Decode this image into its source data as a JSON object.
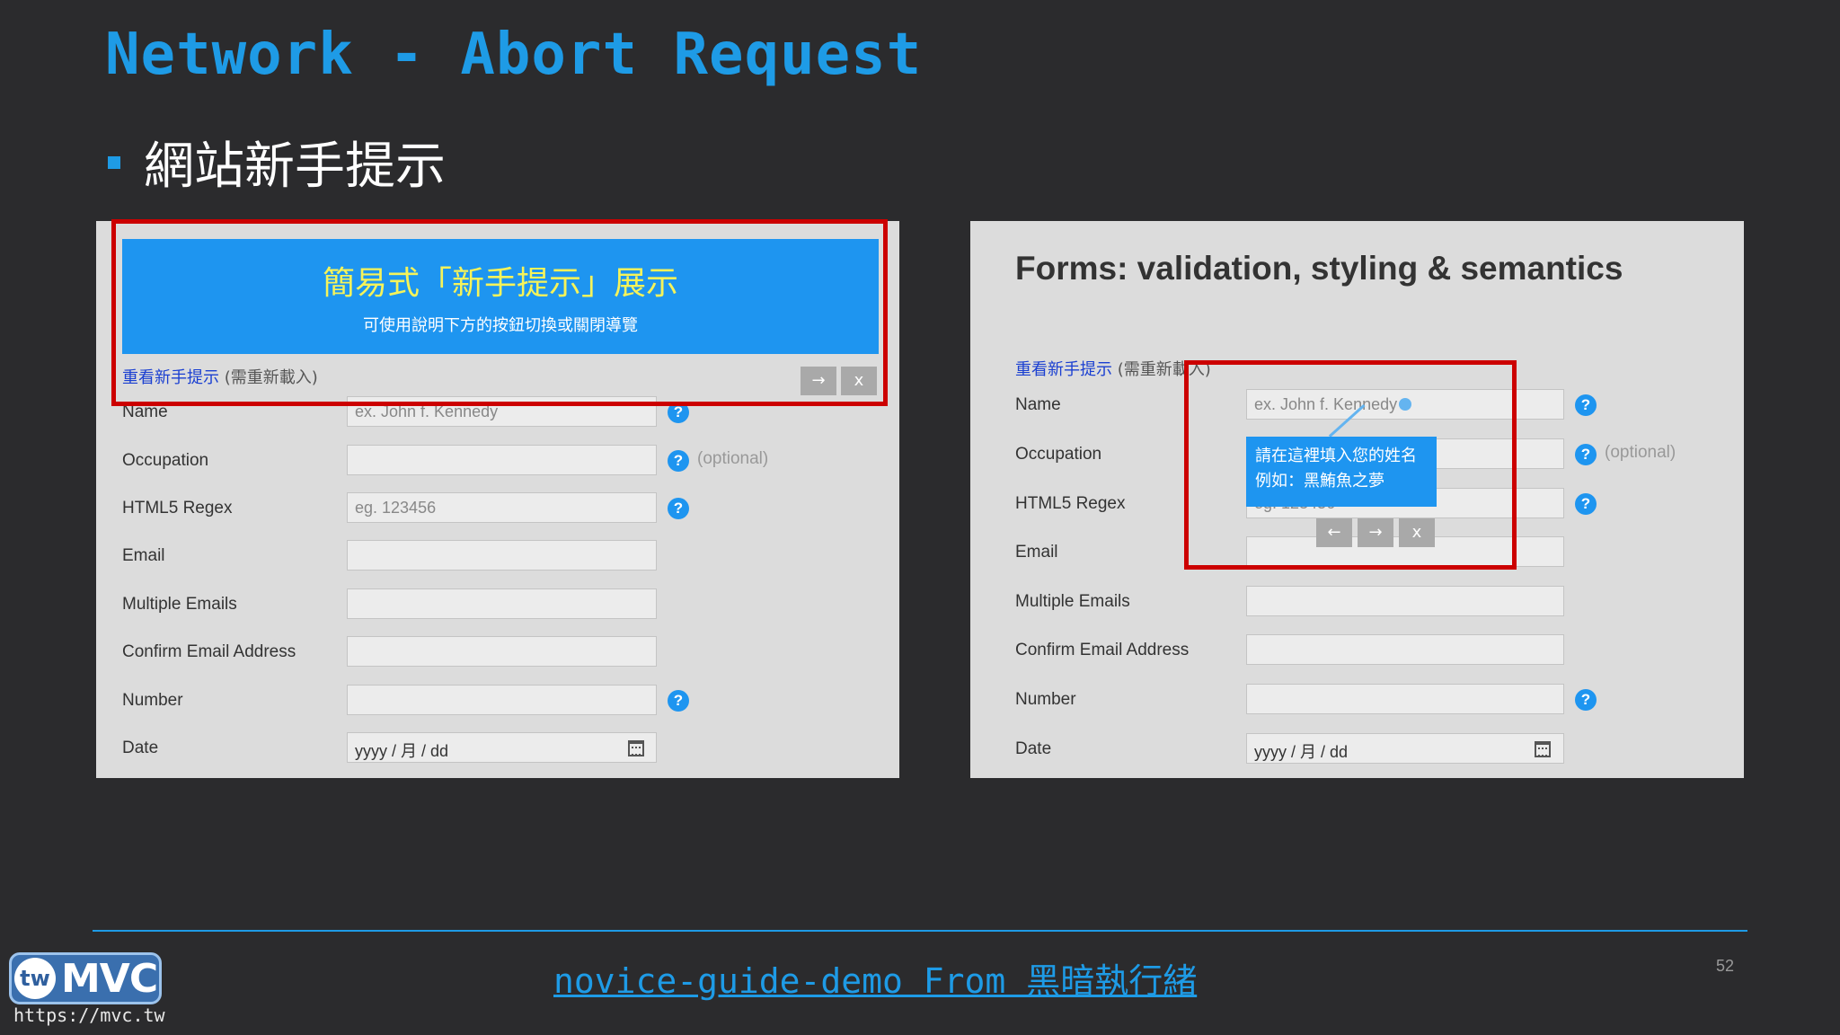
{
  "slide": {
    "title": "Network - Abort Request",
    "bullet": "網站新手提示",
    "footer_link": "novice-guide-demo From 黑暗執行緒",
    "page_number": "52",
    "logo_badge_text": "MVC",
    "logo_circle_text": "tw",
    "logo_url": "https://mvc.tw"
  },
  "colors": {
    "accent": "#1e9be6",
    "highlight_box": "#cc0000",
    "banner_bg": "#1e95f0",
    "banner_title": "#f5f35a"
  },
  "left_panel": {
    "banner_title": "簡易式「新手提示」展示",
    "banner_subtitle": "可使用說明下方的按鈕切換或關閉導覽",
    "reread_link": "重看新手提示",
    "reread_note": "(需重新載入)",
    "next_button": "→",
    "close_button": "x",
    "fields": [
      {
        "label": "Name",
        "placeholder": "ex. John f. Kennedy",
        "help": "?"
      },
      {
        "label": "Occupation",
        "placeholder": "",
        "help": "?",
        "note": "(optional)"
      },
      {
        "label": "HTML5 Regex",
        "placeholder": "eg. 123456",
        "help": "?"
      },
      {
        "label": "Email",
        "placeholder": ""
      },
      {
        "label": "Multiple Emails",
        "placeholder": ""
      },
      {
        "label": "Confirm Email Address",
        "placeholder": ""
      },
      {
        "label": "Number",
        "placeholder": "",
        "help": "?"
      },
      {
        "label": "Date",
        "placeholder": "yyyy / 月 / dd"
      }
    ]
  },
  "right_panel": {
    "title": "Forms: validation, styling & semantics",
    "reread_link": "重看新手提示",
    "reread_note": "(需重新載入)",
    "tooltip_line1": "請在這裡填入您的姓名",
    "tooltip_line2": "例如：黑鮪魚之夢",
    "prev_button": "←",
    "next_button": "→",
    "close_button": "x",
    "fields": [
      {
        "label": "Name",
        "placeholder": "ex. John f. Kennedy",
        "help": "?"
      },
      {
        "label": "Occupation",
        "placeholder": "",
        "help": "?",
        "note": "(optional)"
      },
      {
        "label": "HTML5 Regex",
        "placeholder": "eg. 123456",
        "help": "?"
      },
      {
        "label": "Email",
        "placeholder": ""
      },
      {
        "label": "Multiple Emails",
        "placeholder": ""
      },
      {
        "label": "Confirm Email Address",
        "placeholder": ""
      },
      {
        "label": "Number",
        "placeholder": "",
        "help": "?"
      },
      {
        "label": "Date",
        "placeholder": "yyyy / 月 / dd"
      }
    ]
  }
}
